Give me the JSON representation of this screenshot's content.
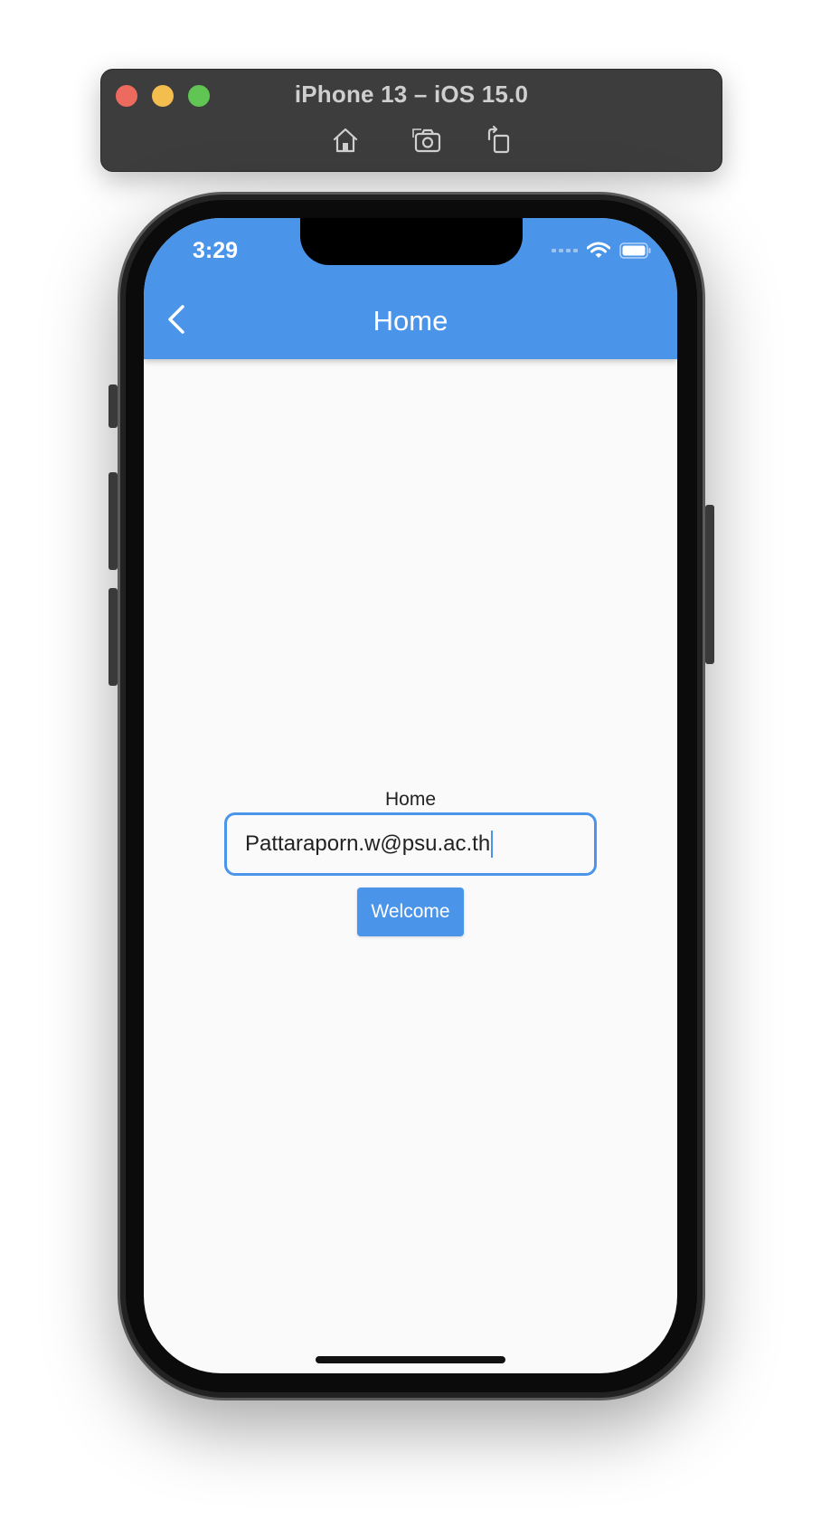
{
  "simulator": {
    "title": "iPhone 13 – iOS 15.0",
    "tools": [
      {
        "icon": "home-icon"
      },
      {
        "icon": "screenshot-icon"
      },
      {
        "icon": "rotate-icon"
      }
    ]
  },
  "status_bar": {
    "time": "3:29"
  },
  "app_bar": {
    "title": "Home"
  },
  "body": {
    "label": "Home",
    "email_value": "Pattaraporn.w@psu.ac.th",
    "button_label": "Welcome"
  },
  "colors": {
    "accent": "#4a94ea",
    "background": "#fafafa"
  }
}
